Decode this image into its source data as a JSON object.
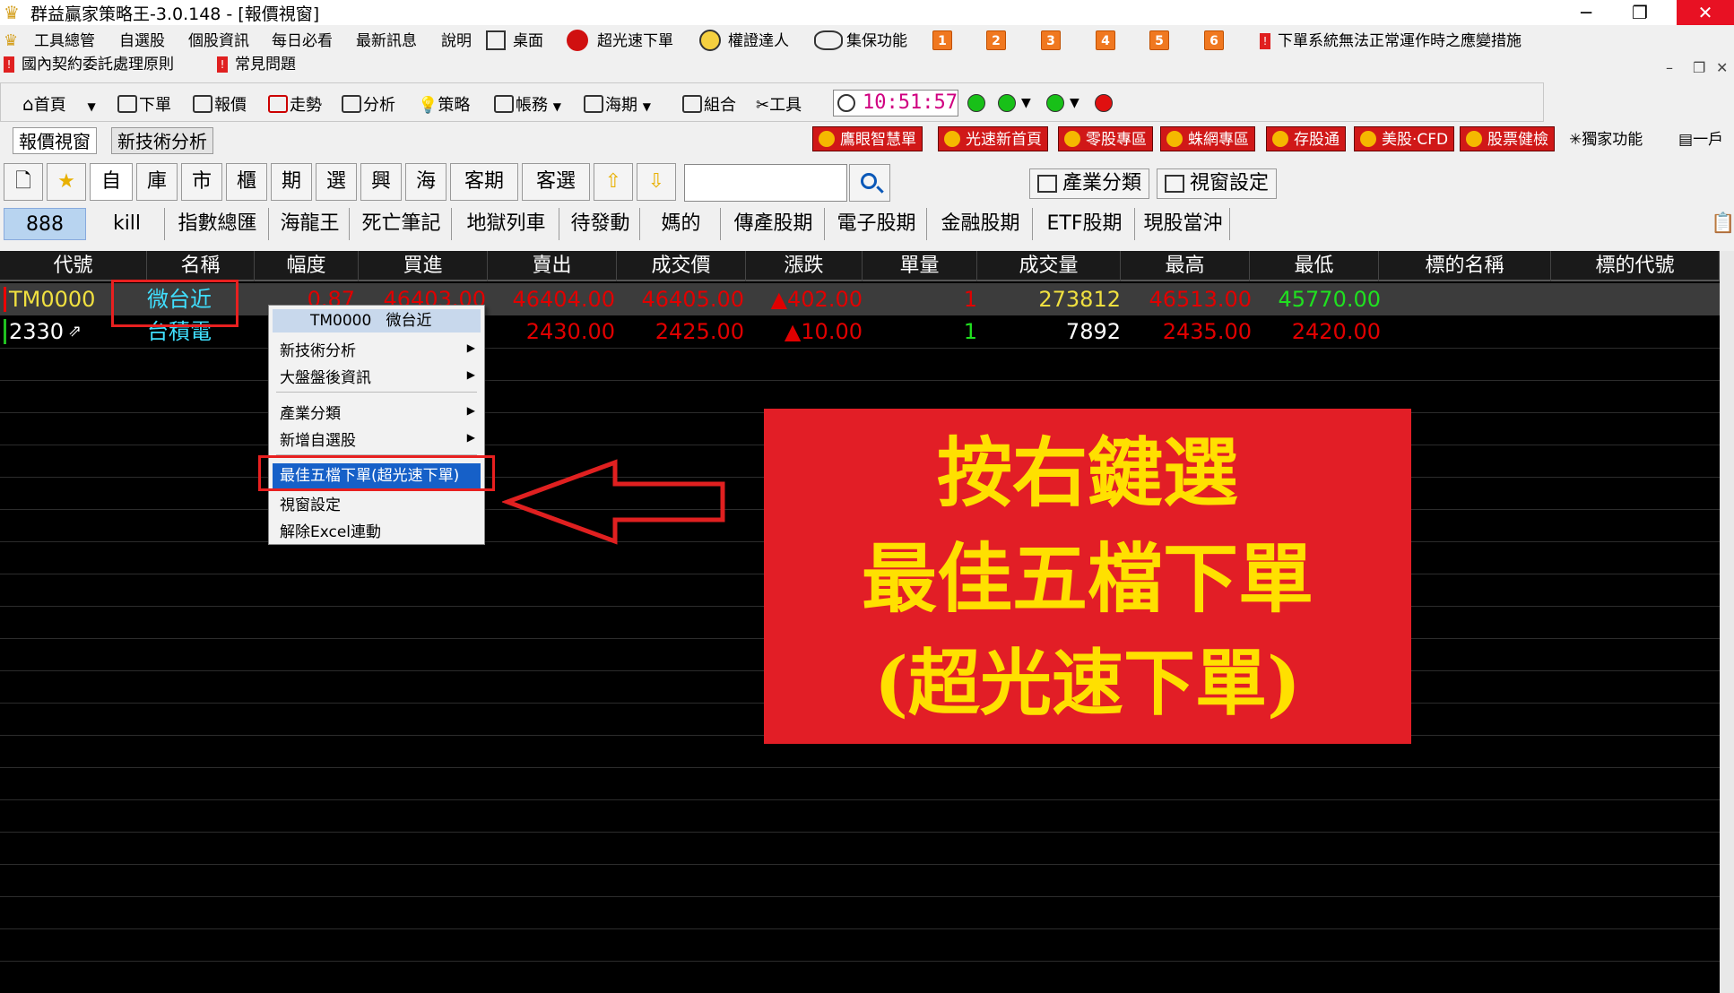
{
  "window": {
    "title": "群益贏家策略王-3.0.148 - [報價視窗]",
    "minimize": "─",
    "restore": "❐",
    "close": "✕"
  },
  "menubar": {
    "items": [
      "工具總管",
      "自選股",
      "個股資訊",
      "每日必看",
      "最新訊息",
      "說明",
      "桌面",
      "超光速下單",
      "權證達人",
      "集保功能"
    ],
    "numbers": [
      "1",
      "2",
      "3",
      "4",
      "5",
      "6"
    ],
    "notice": "下單系統無法正常運作時之應變措施",
    "row2": [
      "國內契約委託處理原則",
      "常見問題"
    ]
  },
  "toolbar": {
    "items": [
      "首頁",
      "下單",
      "報價",
      "走勢",
      "分析",
      "策略",
      "帳務",
      "海期",
      "組合",
      "工具"
    ],
    "clock": "10:51:57",
    "lights": [
      "#18c018",
      "#18c018",
      "#18c018",
      "#e01010"
    ]
  },
  "tabs": {
    "view_tabs": [
      "報價視窗",
      "新技術分析"
    ],
    "promos": [
      "鷹眼智慧單",
      "光速新首頁",
      "零股專區",
      "蛛網專區",
      "存股通",
      "美股‧CFD",
      "股票健檢"
    ],
    "extras": [
      "獨家功能",
      "一戶"
    ]
  },
  "categories": {
    "buttons": [
      "自",
      "庫",
      "市",
      "櫃",
      "期",
      "選",
      "興",
      "海",
      "客期",
      "客選"
    ],
    "right_buttons": [
      "產業分類",
      "視窗設定"
    ],
    "search_placeholder": ""
  },
  "groups": [
    "888",
    "kill",
    "指數總匯",
    "海龍王",
    "死亡筆記",
    "地獄列車",
    "待發動",
    "媽的",
    "傳產股期",
    "電子股期",
    "金融股期",
    "ETF股期",
    "現股當沖"
  ],
  "grid": {
    "headers": [
      "代號",
      "名稱",
      "幅度",
      "買進",
      "賣出",
      "成交價",
      "漲跌",
      "單量",
      "成交量",
      "最高",
      "最低",
      "標的名稱",
      "標的代號"
    ],
    "rows": [
      {
        "code": "TM0000",
        "name": "微台近",
        "range": "0.87",
        "bid": "46403.00",
        "ask": "46404.00",
        "last": "46405.00",
        "change": "▲402.00",
        "vol": "1",
        "total": "273812",
        "high": "46513.00",
        "low": "45770.00"
      },
      {
        "code": "2330",
        "name": "台積電",
        "range": "",
        "bid": "",
        "ask": "2430.00",
        "last": "2425.00",
        "change": "▲10.00",
        "vol": "1",
        "total": "7892",
        "high": "2435.00",
        "low": "2420.00"
      }
    ]
  },
  "context_menu": {
    "header_code": "TM0000",
    "header_name": "微台近",
    "items": [
      "新技術分析",
      "大盤盤後資訊",
      "產業分類",
      "新增自選股",
      "最佳五檔下單(超光速下單)",
      "視窗設定",
      "解除Excel連動"
    ]
  },
  "annotation": {
    "line1": "按右鍵選",
    "line2": "最佳五檔下單",
    "line3": "(超光速下單)",
    "box_color": "#e21e26",
    "text_color": "#ffe000"
  }
}
